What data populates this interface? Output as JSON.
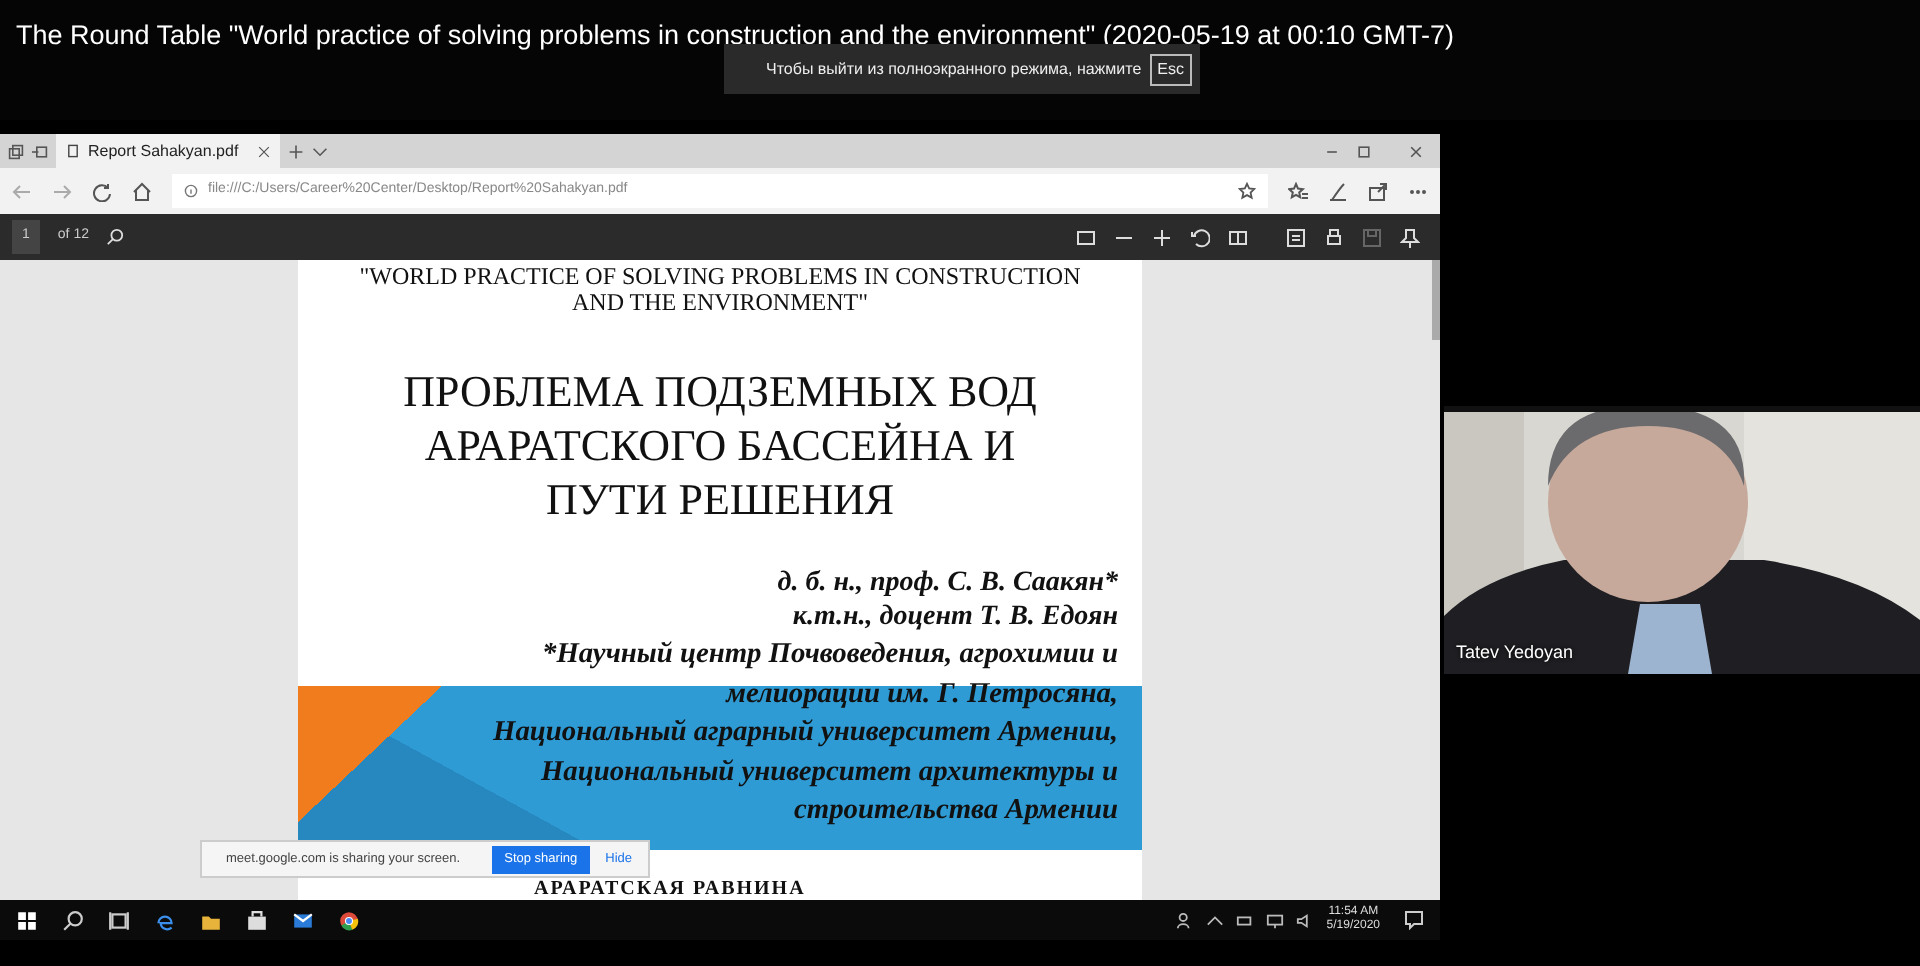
{
  "video_title": "The Round Table \"World practice of solving problems in construction and the environment\" (2020-05-19 at 00:10 GMT-7)",
  "fullscreen_notice": {
    "text": "Чтобы выйти из полноэкранного режима, нажмите",
    "key": "Esc"
  },
  "browser": {
    "tabs": [
      {
        "label": "Report Sahakyan.pdf",
        "selected": true
      }
    ],
    "address": "file:///C:/Users/Career%20Center/Desktop/Report%20Sahakyan.pdf",
    "pdf_toolbar": {
      "page": "1",
      "page_count": "of 12"
    }
  },
  "slide": {
    "conference": "\"WORLD PRACTICE OF SOLVING PROBLEMS IN CONSTRUCTION AND THE ENVIRONMENT\"",
    "title_lines": [
      "ПРОБЛЕМА ПОДЗЕМНЫХ ВОД",
      "АРАРАТСКОГО БАССЕЙНА И",
      "ПУТИ РЕШЕНИЯ"
    ],
    "authors": [
      "д. б. н., проф. С. В. Саакян*",
      "к.т.н., доцент Т. В. Едоян"
    ],
    "affiliation_lines": [
      "*Научный центр Почвоведения, агрохимии и",
      "мелиорации им. Г. Петросяна,",
      "Национальный аграрный университет Армении,",
      "Национальный университет архитектуры и",
      "строительства Армении"
    ],
    "next_heading": "АРАРАТСКАЯ РАВНИНА"
  },
  "sharing_bar": {
    "message": "meet.google.com is sharing your screen.",
    "stop_button": "Stop sharing",
    "hide_link": "Hide"
  },
  "taskbar": {
    "time": "11:54 AM",
    "date": "5/19/2020"
  },
  "participant": {
    "name": "Tatev Yedoyan"
  }
}
